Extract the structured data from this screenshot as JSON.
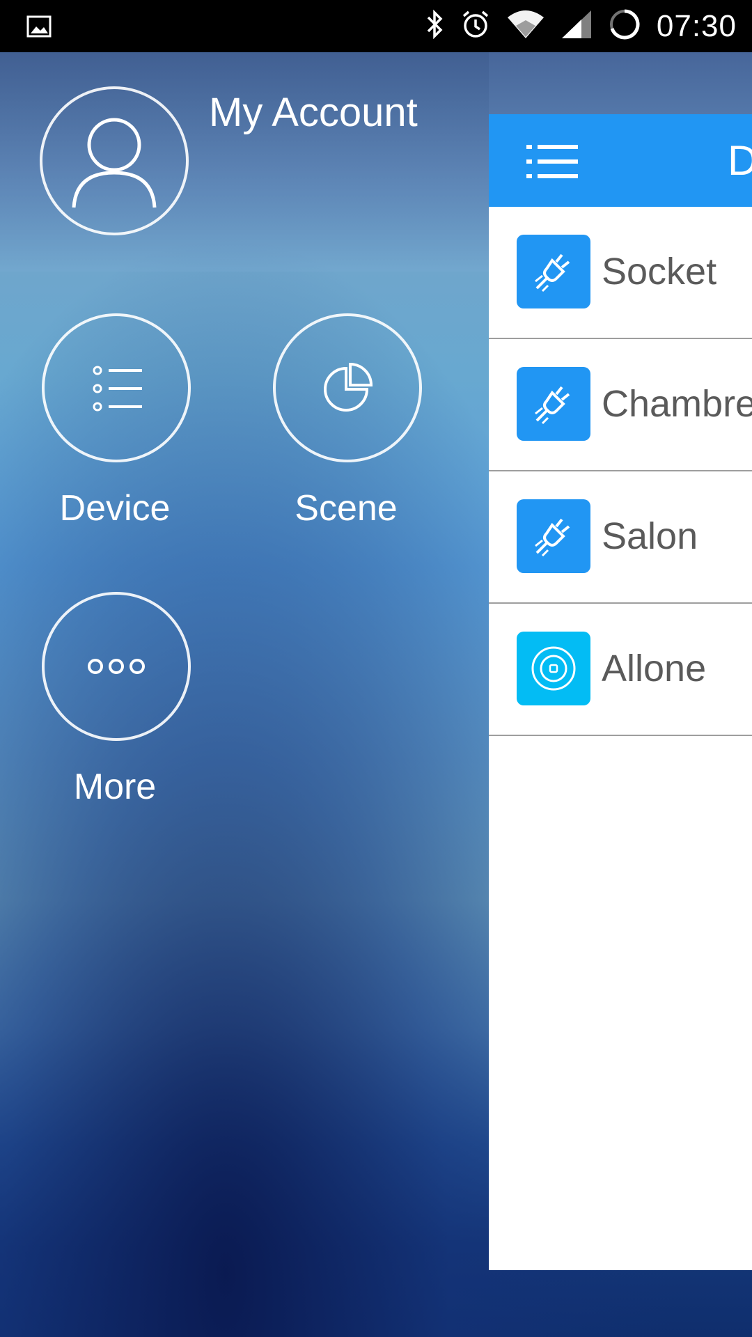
{
  "status_bar": {
    "time": "07:30"
  },
  "drawer": {
    "account_title": "My Account",
    "tiles": [
      {
        "label": "Device"
      },
      {
        "label": "Scene"
      },
      {
        "label": "More"
      }
    ]
  },
  "panel": {
    "title": "D",
    "items": [
      {
        "name": "Socket",
        "icon": "plug-icon",
        "color": "#2196f3"
      },
      {
        "name": "Chambre",
        "icon": "plug-icon",
        "color": "#2196f3"
      },
      {
        "name": "Salon",
        "icon": "plug-icon",
        "color": "#2196f3"
      },
      {
        "name": "Allone",
        "icon": "target-icon",
        "color": "#03bcf4"
      }
    ]
  }
}
